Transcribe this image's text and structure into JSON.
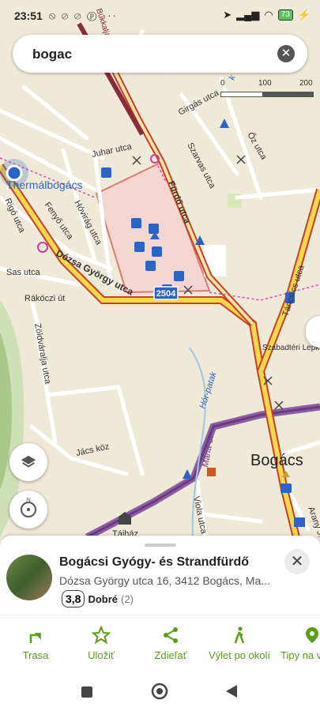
{
  "status": {
    "time": "23:51",
    "left_icons": "⦸ ⊘ ⊘ ⓟ ···",
    "battery": "73"
  },
  "search": {
    "query": "bogac"
  },
  "scale": {
    "l0": "0",
    "l1": "100",
    "l2": "200"
  },
  "map_labels": {
    "thermal": "Thermálbogács",
    "juhar": "Juhar utca",
    "girgas": "Girgás utca",
    "oz": "Őz utca",
    "szarvas": "Szarvas utca",
    "furdo": "Fürdő utca",
    "rigo": "Rigó utca",
    "fenyo": "Fenyő utca",
    "hovirag": "Hóvirág utca",
    "sas": "Sas utca",
    "dozsa": "Dózsa György utca",
    "rakoczi": "Rákóczi út",
    "road_no": "2504",
    "zoldvaralja": "Zöldváralja utca",
    "tancsics": "Táncsics utca",
    "szabadteri": "Szabadtéri Lepke",
    "horpatak": "Hór-patak",
    "jacs": "Jács köz",
    "maria": "Mária-út",
    "bogacs": "Bogács",
    "viola": "Viola utca",
    "arany": "Arany J.",
    "tajhaz": "Tájház",
    "bukkalja": "Bükkalja",
    "patak_k": "k"
  },
  "poi": {
    "title": "Bogácsi Gyógy- és Strandfürdő",
    "address": "Dózsa György utca 16, 3412 Bogács, Ma...",
    "score": "3,8",
    "rating_word": "Dobré",
    "rating_count": "(2)"
  },
  "actions": {
    "route": "Trasa",
    "save": "Uložiť",
    "share": "Zdieľať",
    "trip": "Výlet po okolí",
    "tips": "Tipy na v"
  },
  "colors": {
    "accent": "#5a9e1a",
    "main_road": "#f7d64a",
    "road_casing": "#c8402a",
    "trail": "#9b59b6"
  }
}
